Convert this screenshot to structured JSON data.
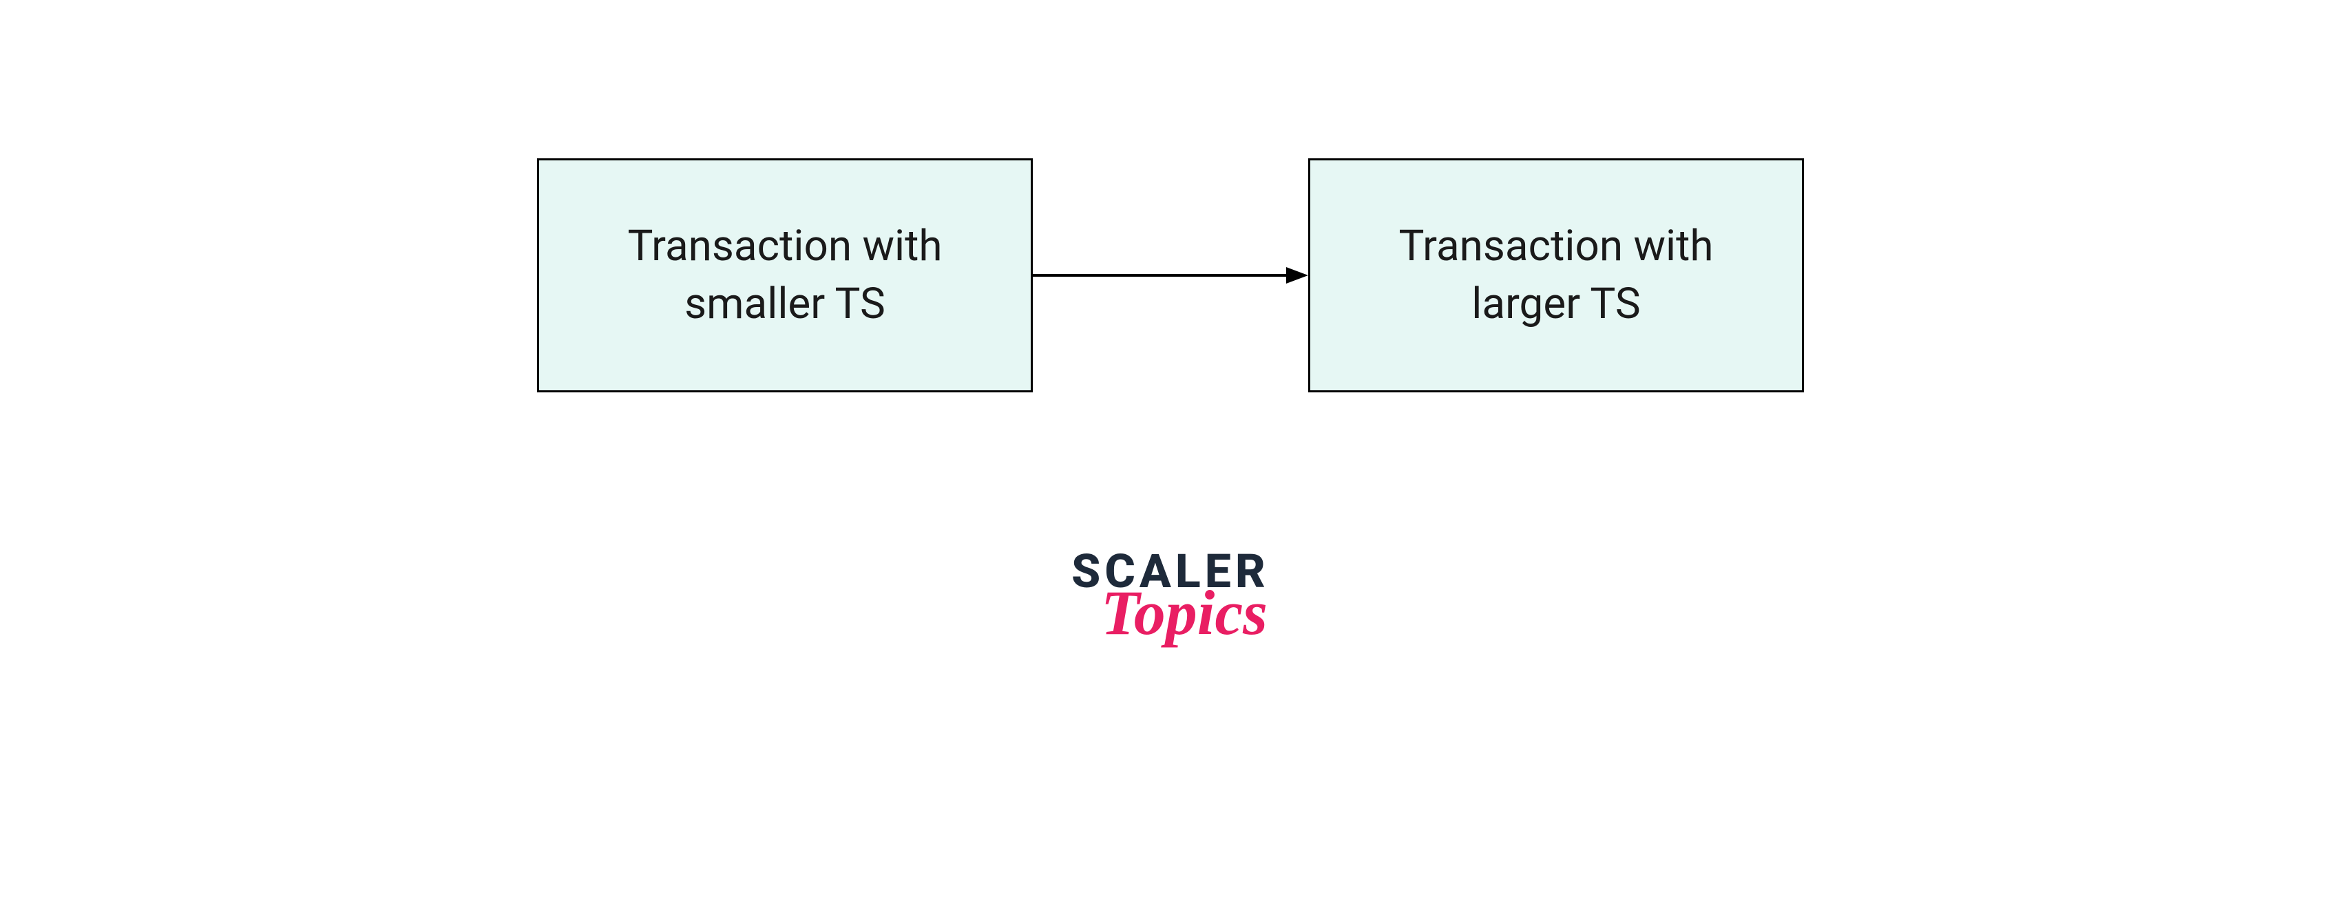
{
  "diagram": {
    "left_box": {
      "line1": "Transaction with",
      "line2": "smaller TS"
    },
    "right_box": {
      "line1": "Transaction with",
      "line2": "larger TS"
    }
  },
  "logo": {
    "primary": "SCALER",
    "secondary": "Topics"
  },
  "colors": {
    "box_fill": "#e6f7f4",
    "box_border": "#000000",
    "text": "#1a1a1a",
    "logo_primary": "#1e2a3a",
    "logo_secondary": "#e91e63"
  }
}
